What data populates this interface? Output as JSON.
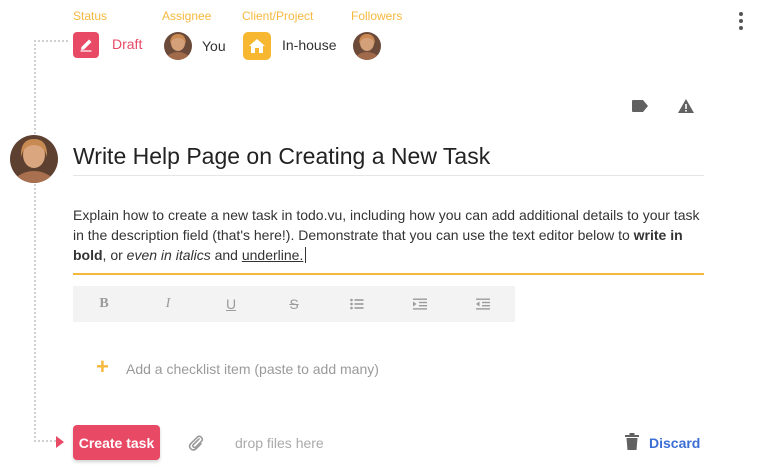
{
  "meta": {
    "status": {
      "label": "Status",
      "value": "Draft"
    },
    "assignee": {
      "label": "Assignee",
      "value": "You"
    },
    "client": {
      "label": "Client/Project",
      "value": "In-house"
    },
    "followers": {
      "label": "Followers"
    }
  },
  "task": {
    "title": "Write Help Page on Creating a New Task",
    "desc": {
      "part1": "Explain how to create a new task in todo.vu, including how you can add additional details to your task in the description field (that's here!). Demonstrate that you can use the text editor below to ",
      "bold": "write in bold",
      "part2": ", or ",
      "italic": "even in italics",
      "part3": " and ",
      "underline": "underline."
    }
  },
  "toolbar": {
    "bold": "B",
    "italic": "I",
    "underline": "U",
    "strike": "S"
  },
  "checklist": {
    "placeholder": "Add a checklist item (paste to add many)",
    "plus": "+"
  },
  "footer": {
    "create_label": "Create task",
    "drop_label": "drop files here",
    "discard_label": "Discard"
  },
  "colors": {
    "accent": "#e84a66",
    "label": "#f5b83d",
    "discard": "#3b6fd6"
  }
}
